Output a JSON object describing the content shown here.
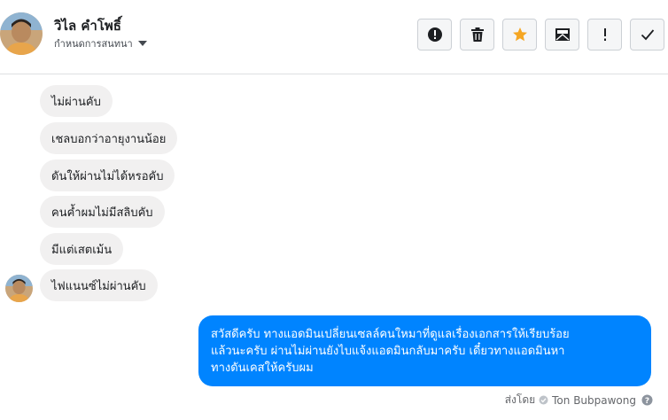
{
  "header": {
    "contact_name": "วิไล คำโพธิ์",
    "settings_label": "กำหนดการสนทนา"
  },
  "toolbar": {
    "buttons": [
      {
        "icon": "report-icon",
        "label": "Report"
      },
      {
        "icon": "trash-icon",
        "label": "Delete"
      },
      {
        "icon": "star-icon",
        "label": "Star",
        "color": "#f5a623"
      },
      {
        "icon": "mark-unread-icon",
        "label": "Mark as unread"
      },
      {
        "icon": "important-icon",
        "label": "!"
      },
      {
        "icon": "checkmark-icon",
        "label": "Done"
      }
    ]
  },
  "messages": {
    "incoming": [
      "ไม่ผ่านคับ",
      "เชลบอกว่าอายุงานน้อย",
      "ดันให้ผ่านไม่ได้หรอคับ",
      "คนค้ำผมไม่มีสลิบคับ",
      "มีแต่เสตเม้น",
      "ไฟแนนซ์ไม่ผ่านคับ"
    ],
    "outgoing": {
      "lines": [
        "สวัสดีครับ ทางแอดมินเปลี่ยนเซลล์คนใหมาที่ดูแลเรื่องเอกสารให้เรียบร้อย",
        "แล้วนะครับ ผ่านไม่ผ่านยังไบแจ้งแอดมินกลับมาครับ เดี๋ยวทางแอดมินหา",
        "ทางดันเคสให้ครับผม"
      ],
      "color": "#0084ff"
    },
    "sent_by_label": "ส่งโดย",
    "sent_by_name": "Ton Bubpawong"
  }
}
